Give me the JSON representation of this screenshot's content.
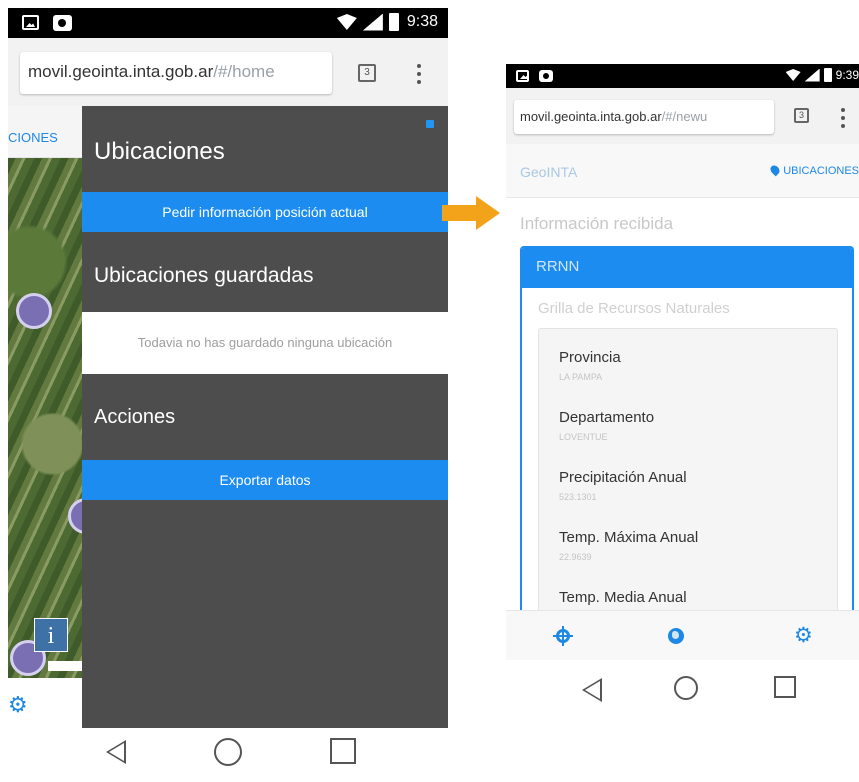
{
  "left_phone": {
    "status_bar": {
      "time": "9:38"
    },
    "address_bar": {
      "url_host": "movil.geointa.inta.gob.ar",
      "url_path": "/#/home",
      "tab_count": "3"
    },
    "nav_underlay": {
      "label": "CIONES"
    },
    "map": {
      "info_button": "i"
    },
    "drawer": {
      "title": "Ubicaciones",
      "request_button": "Pedir información posición actual",
      "saved_heading": "Ubicaciones guardadas",
      "saved_empty_message": "Todavia no has guardado ninguna ubicación",
      "actions_heading": "Acciones",
      "export_button": "Exportar datos"
    }
  },
  "right_phone": {
    "status_bar": {
      "time": "9:39"
    },
    "address_bar": {
      "url_host": "movil.geointa.inta.gob.ar",
      "url_path": "/#/newu",
      "tab_count": "3"
    },
    "navbar": {
      "brand": "GeoINTA",
      "locations_link": "UBICACIONES"
    },
    "section_title": "Información recibida",
    "panel": {
      "heading": "RRNN",
      "subtitle": "Grilla de Recursos Naturales",
      "fields": [
        {
          "label": "Provincia",
          "value": "LA PAMPA"
        },
        {
          "label": "Departamento",
          "value": "LOVENTUE"
        },
        {
          "label": "Precipitación Anual",
          "value": "523.1301"
        },
        {
          "label": "Temp. Máxima Anual",
          "value": "22.9639"
        },
        {
          "label": "Temp. Media Anual",
          "value": ""
        }
      ]
    }
  },
  "colors": {
    "accent_blue": "#1c8cf1",
    "drawer_bg": "#4d4d4d",
    "arrow_orange": "#f2a31a"
  },
  "icons": [
    "image-icon",
    "camera-icon",
    "wifi-icon",
    "signal-icon",
    "battery-icon",
    "tabs-icon",
    "more-vert-icon",
    "map-pin-icon",
    "crosshair-icon",
    "globe-icon",
    "gear-icon",
    "back-icon",
    "home-icon",
    "recents-icon"
  ]
}
